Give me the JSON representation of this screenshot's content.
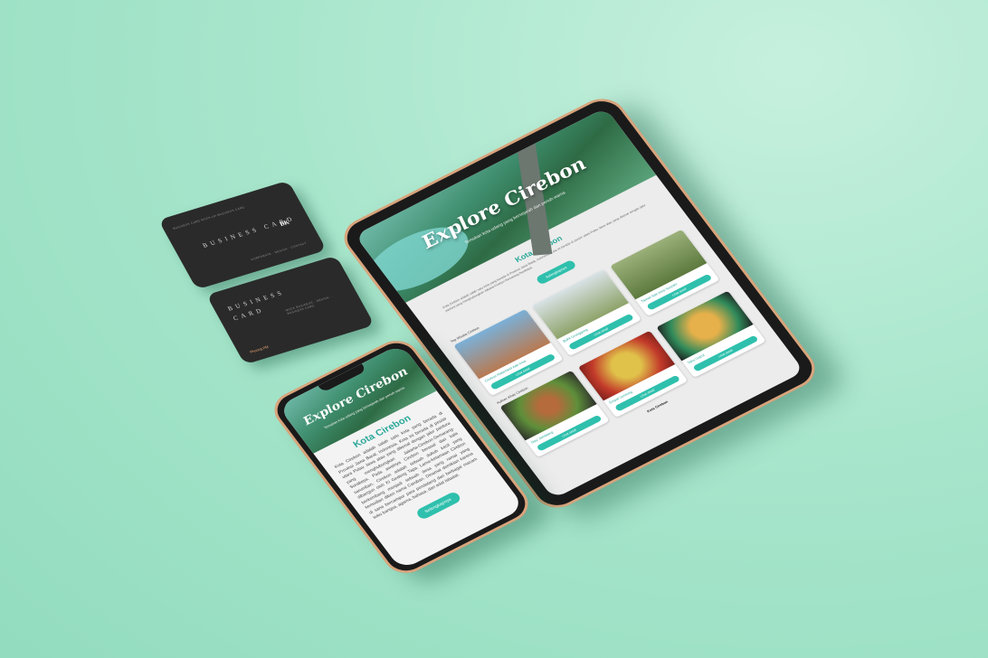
{
  "cards": {
    "card1": {
      "title": "BUSINESS CARD",
      "tagline": "BUSINESS CARD MOCK-UP BUSINESS CARD",
      "logo": "BK",
      "footer": "CORPORATE · DESIGN · CONTACT"
    },
    "card2": {
      "title_line1": "BUSINESS",
      "title_line2": "CARD",
      "details": "MOCK BUSINESS · DESIGN · BUSINESS CARD",
      "name": "Phuong PM"
    }
  },
  "tablet": {
    "hero_title": "Explore Cirebon",
    "hero_subtitle": "Temukan kota udang yang bersejarah dan penuh warna",
    "section_title": "Kota Cirebon",
    "intro_text": "Kota Cirebon adalah salah satu kota yang berada di Provinsi Jawa Barat, Indonesia. Kota ini berada di pesisir utara Pulau Jawa atau yang dikenal dengan jalur pantura yang menghubungkan Jakarta-Cirebon-Semarang-Surabaya.",
    "read_more": "Selengkapnya",
    "tourism_label": "Top Wisata Cirebon",
    "tourism": [
      {
        "name": "Cirebon Waterland Ade Irma",
        "button": "Lihat detail"
      },
      {
        "name": "Bukit Gronggong",
        "button": "Lihat detail"
      },
      {
        "name": "Taman Ade Irma Suryani",
        "button": "Lihat detail"
      }
    ],
    "culinary_label": "Kuliner Khas Cirebon",
    "culinary": [
      {
        "name": "Nasi Jamblang",
        "button": "Lihat detail"
      },
      {
        "name": "Empal Gentong",
        "button": "Lihat detail"
      },
      {
        "name": "Tahu Gejrot",
        "button": "Lihat detail"
      }
    ],
    "footer": "Kota Cirebon"
  },
  "phone": {
    "hero_title": "Explore Cirebon",
    "hero_subtitle": "Temukan kota udang yang bersejarah dan penuh warna",
    "section_title": "Kota Cirebon",
    "intro_text": "Kota Cirebon adalah salah satu kota yang berada di Provinsi Jawa Barat, Indonesia. Kota ini berada di pesisir utara Pulau Jawa atau yang dikenal dengan jalur pantura yang menghubungkan Jakarta-Cirebon-Semarang-Surabaya. Pada awalnya Cirebon berasal dari kata sarumban, Cirebon adalah sebuah dukuh kecil yang dibangun oleh Ki Gedeng Tapa. Lama-kelamaan Cirebon berkembang menjadi sebuah desa yang ramai yang kemudian diberi nama Caruban. Dinamai demikian karena di sana bercampur para pendatang dari berbagai macam suku bangsa, agama, bahasa, dan adat istiadat.",
    "read_more": "Selengkapnya"
  }
}
